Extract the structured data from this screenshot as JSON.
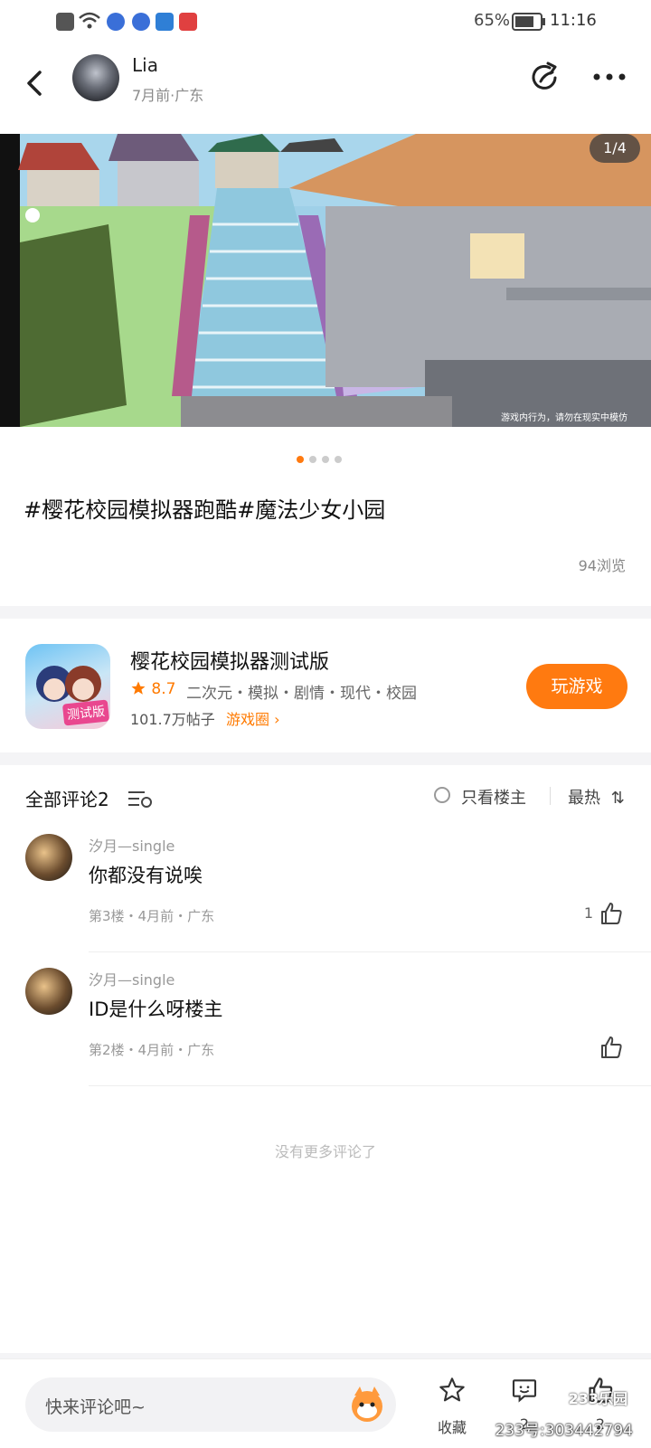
{
  "status_bar": {
    "battery": "65%",
    "time": "11:16"
  },
  "header": {
    "author_name": "Lia",
    "author_meta": "7月前·广东"
  },
  "post": {
    "page_counter": "1/4",
    "image_warning": "游戏内行为，请勿在现实中模仿",
    "title": "#樱花校园模拟器跑酷#魔法少女小园",
    "views": "94浏览"
  },
  "game": {
    "name": "樱花校园模拟器测试版",
    "icon_badge": "测试版",
    "rating": "8.7",
    "tags": "二次元・模拟・剧情・现代・校园",
    "posts": "101.7万帖子",
    "circle_link": "游戏圈",
    "play_button": "玩游戏"
  },
  "comments": {
    "title": "全部评论2",
    "only_author": "只看楼主",
    "sort": "最热",
    "items": [
      {
        "name": "汐月—single",
        "text": "你都没有说唉",
        "meta": "第3楼・4月前・广东",
        "likes": "1"
      },
      {
        "name": "汐月—single",
        "text": "ID是什么呀楼主",
        "meta": "第2楼・4月前・广东",
        "likes": ""
      }
    ],
    "no_more": "没有更多评论了"
  },
  "bottom_bar": {
    "placeholder": "快来评论吧~",
    "favorite_label": "收藏",
    "comment_count": "2",
    "like_count": "2"
  },
  "watermark": {
    "logo": "233乐园",
    "text": "233号:303442794"
  },
  "colors": {
    "accent": "#ff7a10",
    "rating": "#ff7a00"
  }
}
